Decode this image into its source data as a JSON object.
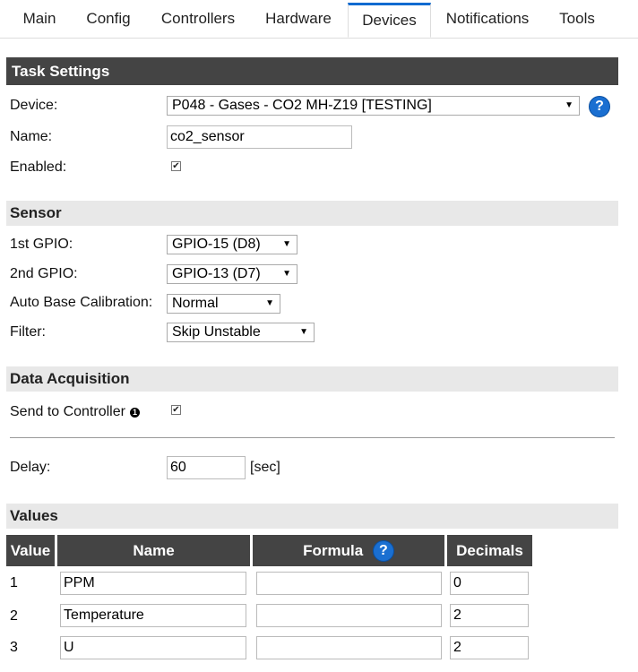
{
  "tabs": [
    {
      "label": "Main"
    },
    {
      "label": "Config"
    },
    {
      "label": "Controllers"
    },
    {
      "label": "Hardware"
    },
    {
      "label": "Devices"
    },
    {
      "label": "Notifications"
    },
    {
      "label": "Tools"
    }
  ],
  "task_settings": {
    "title": "Task Settings",
    "device_label": "Device:",
    "device_value": "P048 - Gases - CO2 MH-Z19 [TESTING]",
    "help_glyph": "?",
    "name_label": "Name:",
    "name_value": "co2_sensor",
    "enabled_label": "Enabled:",
    "enabled_checked": true
  },
  "sensor": {
    "title": "Sensor",
    "gpio1_label": "1st GPIO:",
    "gpio1_value": "GPIO-15 (D8)",
    "gpio2_label": "2nd GPIO:",
    "gpio2_value": "GPIO-13 (D7)",
    "abc_label": "Auto Base Calibration:",
    "abc_value": "Normal",
    "filter_label": "Filter:",
    "filter_value": "Skip Unstable"
  },
  "data_acquisition": {
    "title": "Data Acquisition",
    "send_label": "Send to Controller",
    "send_info_glyph": "1",
    "send_checked": true,
    "delay_label": "Delay:",
    "delay_value": "60",
    "delay_unit": "[sec]"
  },
  "values": {
    "title": "Values",
    "headers": {
      "value": "Value",
      "name": "Name",
      "formula": "Formula",
      "decimals": "Decimals"
    },
    "help_glyph": "?",
    "rows": [
      {
        "index": "1",
        "name": "PPM",
        "formula": "",
        "decimals": "0"
      },
      {
        "index": "2",
        "name": "Temperature",
        "formula": "",
        "decimals": "2"
      },
      {
        "index": "3",
        "name": "U",
        "formula": "",
        "decimals": "2"
      }
    ]
  },
  "colors": {
    "tab_accent": "#0f6bd0",
    "header_dark": "#444444",
    "header_light": "#e8e8e8",
    "help_blue": "#1a6fd1"
  }
}
